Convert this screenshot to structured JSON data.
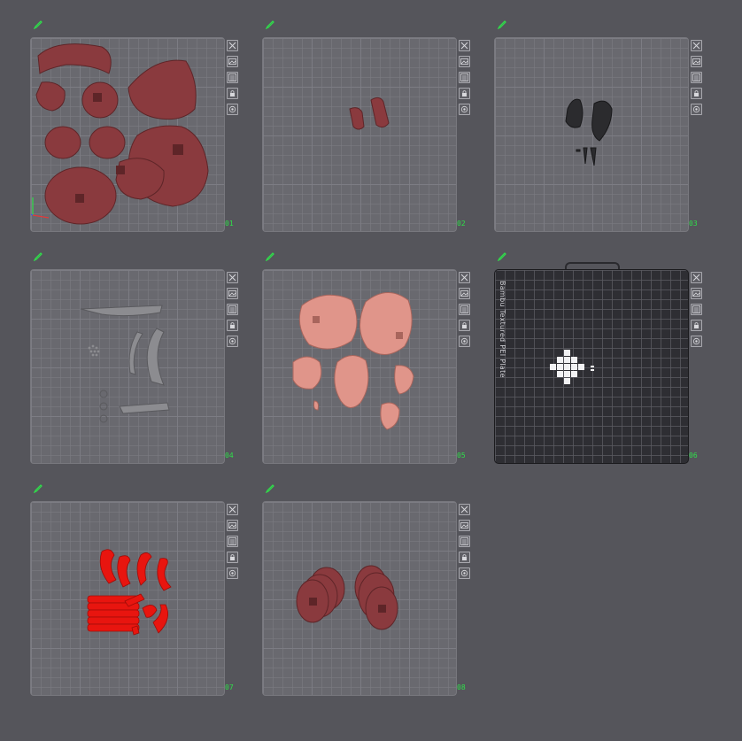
{
  "plates": [
    {
      "id": "01",
      "label": "01",
      "textured": false
    },
    {
      "id": "02",
      "label": "02",
      "textured": false
    },
    {
      "id": "03",
      "label": "03",
      "textured": false
    },
    {
      "id": "04",
      "label": "04",
      "textured": false
    },
    {
      "id": "05",
      "label": "05",
      "textured": false
    },
    {
      "id": "06",
      "label": "06",
      "textured": true,
      "plate_name": "Bambu Textured PEI Plate"
    },
    {
      "id": "07",
      "label": "07",
      "textured": false
    },
    {
      "id": "08",
      "label": "08",
      "textured": false
    }
  ],
  "tools": [
    "close-icon",
    "image-icon",
    "arrange-icon",
    "lock-icon",
    "settings-icon"
  ],
  "colors": {
    "background": "#55555b",
    "plate": "#69696f",
    "label": "#2fe04a",
    "model_dark_red": "#8a3a3e",
    "model_pink": "#e0958a",
    "model_gray": "#8c8c90",
    "model_black": "#2b2b2e",
    "model_red": "#e8150f"
  }
}
